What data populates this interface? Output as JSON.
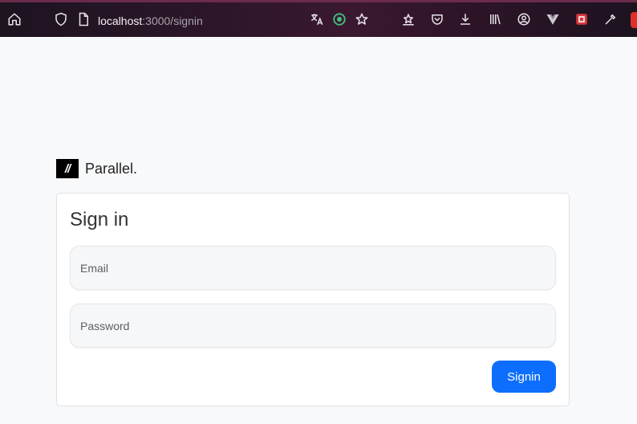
{
  "browser": {
    "url_host": "localhost",
    "url_path": ":3000/signin",
    "icons": [
      "home-icon",
      "shield-icon",
      "page-icon",
      "translate-icon",
      "extension-green-icon",
      "bookmark-star-icon",
      "pocket-star-icon",
      "pocket-icon",
      "download-icon",
      "library-icon",
      "account-icon",
      "vue-devtools-icon",
      "extension-red-icon",
      "color-picker-icon"
    ]
  },
  "brand": {
    "logo_text": "//",
    "name": "Parallel."
  },
  "signin": {
    "title": "Sign in",
    "email_placeholder": "Email",
    "email_value": "",
    "password_placeholder": "Password",
    "password_value": "",
    "button_label": "Signin"
  },
  "colors": {
    "accent": "#0d6efd",
    "page_bg": "#f8f9fa",
    "toolbar_bg": "#2a1627"
  }
}
